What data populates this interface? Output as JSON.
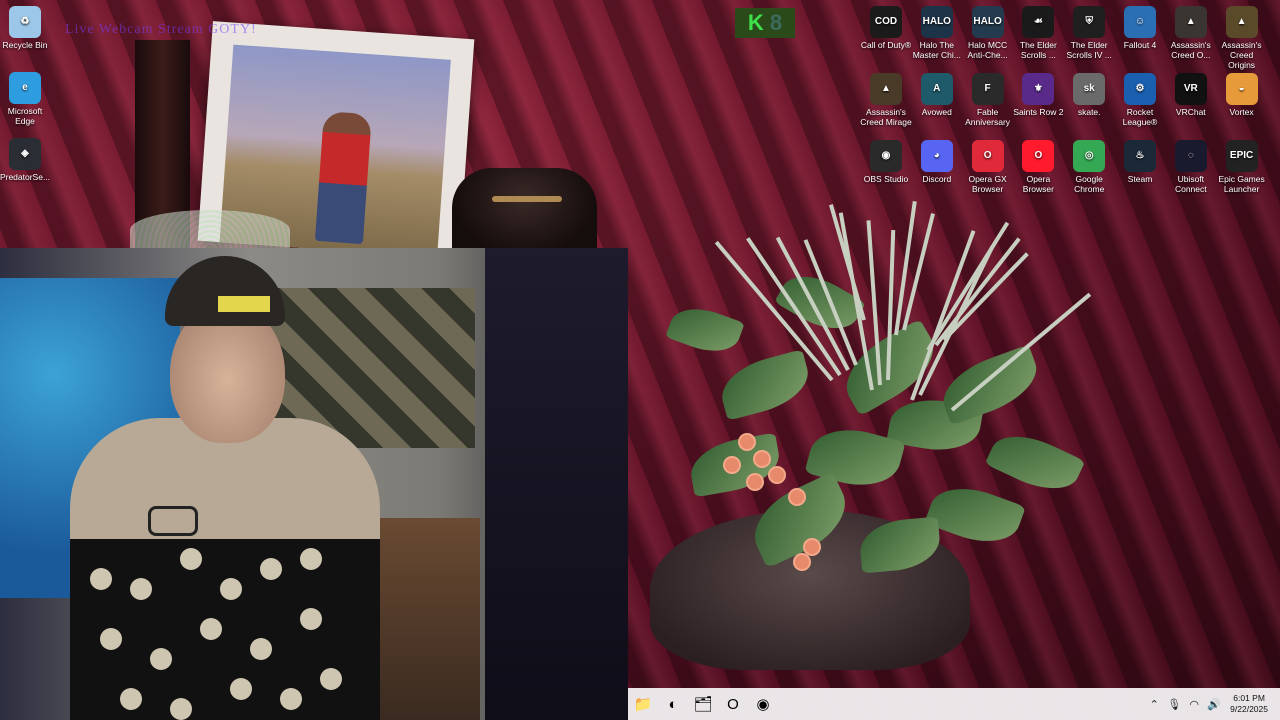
{
  "overlay": {
    "text": "Live Webcam Stream GOTY!",
    "logo_letter": "K"
  },
  "desktop": {
    "left_icons": [
      {
        "label": "Recycle Bin",
        "glyph": "♻",
        "color": "#9cc7e8"
      },
      {
        "label": "Microsoft Edge",
        "glyph": "e",
        "color": "#2e9de0"
      },
      {
        "label": "PredatorSe...",
        "glyph": "◈",
        "color": "#2a2d33"
      }
    ],
    "right_icons": [
      {
        "label": "Call of Duty®",
        "glyph": "COD",
        "color": "#1b1b1b"
      },
      {
        "label": "Halo The Master Chi...",
        "glyph": "HALO",
        "color": "#1d3348"
      },
      {
        "label": "Halo MCC Anti-Che...",
        "glyph": "HALO",
        "color": "#243a4f"
      },
      {
        "label": "The Elder Scrolls ...",
        "glyph": "☙",
        "color": "#1a1a1a"
      },
      {
        "label": "The Elder Scrolls IV ...",
        "glyph": "⛨",
        "color": "#1f1f1f"
      },
      {
        "label": "Fallout 4",
        "glyph": "☺",
        "color": "#2a6fb3"
      },
      {
        "label": "Assassin's Creed O...",
        "glyph": "▲",
        "color": "#3a3530"
      },
      {
        "label": "Assassin's Creed Origins",
        "glyph": "▲",
        "color": "#5a4a2a"
      },
      {
        "label": "Assassin's Creed Mirage",
        "glyph": "▲",
        "color": "#4a3a28"
      },
      {
        "label": "Avowed",
        "glyph": "A",
        "color": "#1f5a6a"
      },
      {
        "label": "Fable Anniversary",
        "glyph": "F",
        "color": "#2a2a2a"
      },
      {
        "label": "Saints Row 2",
        "glyph": "⚜",
        "color": "#5a2a8a"
      },
      {
        "label": "skate.",
        "glyph": "sk",
        "color": "#6a6a6a"
      },
      {
        "label": "Rocket League®",
        "glyph": "⚙",
        "color": "#1b5fb0"
      },
      {
        "label": "VRChat",
        "glyph": "VR",
        "color": "#111111"
      },
      {
        "label": "Vortex",
        "glyph": "◒",
        "color": "#e79a3a"
      },
      {
        "label": "OBS Studio",
        "glyph": "◉",
        "color": "#2a2a2a"
      },
      {
        "label": "Discord",
        "glyph": "◕",
        "color": "#5865f2"
      },
      {
        "label": "Opera GX Browser",
        "glyph": "O",
        "color": "#e02a3a"
      },
      {
        "label": "Opera Browser",
        "glyph": "O",
        "color": "#ff1b2d"
      },
      {
        "label": "Google Chrome",
        "glyph": "◎",
        "color": "#34a853"
      },
      {
        "label": "Steam",
        "glyph": "♨",
        "color": "#1b2838"
      },
      {
        "label": "Ubisoft Connect",
        "glyph": "◌",
        "color": "#1a1a2e"
      },
      {
        "label": "Epic Games Launcher",
        "glyph": "EPIC",
        "color": "#222222"
      }
    ]
  },
  "taskbar": {
    "buttons": [
      {
        "name": "file-explorer",
        "glyph": "📁"
      },
      {
        "name": "edge",
        "glyph": "◐"
      },
      {
        "name": "folder",
        "glyph": "🗂"
      },
      {
        "name": "opera-gx",
        "glyph": "O"
      },
      {
        "name": "obs",
        "glyph": "◉"
      }
    ],
    "tray": {
      "time": "6:01 PM",
      "date": "9/22/2025"
    }
  }
}
